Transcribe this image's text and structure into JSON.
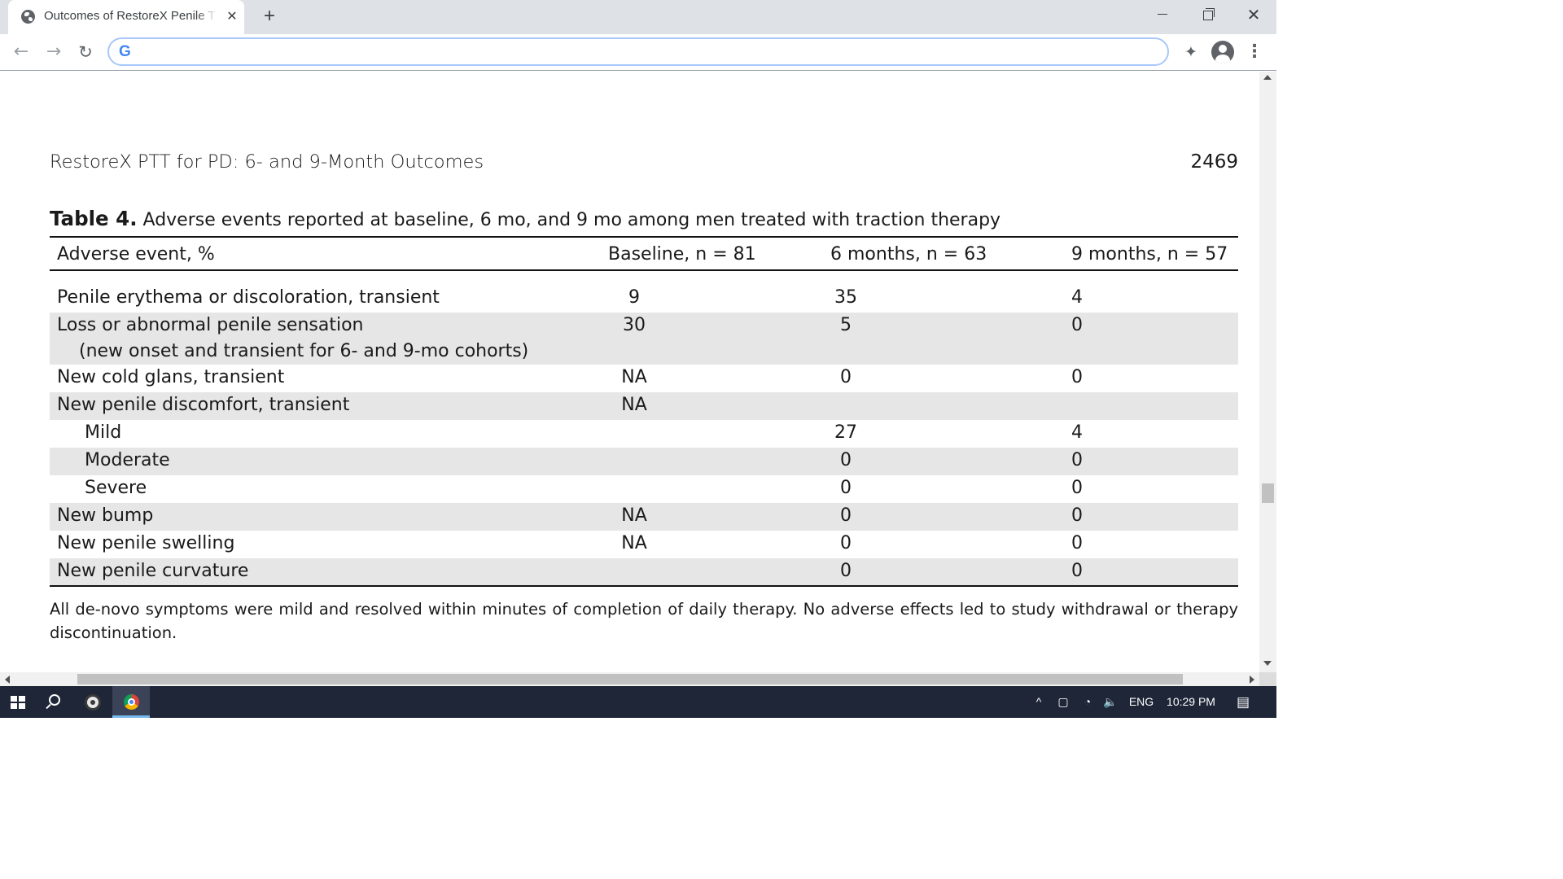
{
  "browser": {
    "tab_title": "Outcomes of RestoreX Penile Traction Therapy",
    "tab_close": "✕",
    "new_tab": "+",
    "window_close": "✕",
    "address_value": "",
    "search_engine_glyph": "G",
    "back_icon": "←",
    "forward_icon": "→",
    "reload_icon": "↻",
    "extensions_icon": "✦",
    "menu_icon": "⋮"
  },
  "document": {
    "running_head": "RestoreX PTT for PD: 6- and 9-Month Outcomes",
    "page_number": "2469",
    "caption_label": "Table 4.",
    "caption_text": "Adverse events reported at baseline, 6 mo, and 9 mo among men treated with traction therapy",
    "headers": [
      "Adverse event, %",
      "Baseline, n = 81",
      "6 months, n = 63",
      "9 months, n = 57"
    ],
    "rows": [
      {
        "label": "Penile erythema or discoloration, transient",
        "sublabel": "",
        "baseline": "9",
        "six": "35",
        "nine": "4"
      },
      {
        "label": "Loss or abnormal penile sensation",
        "sublabel": "(new onset and transient for 6- and 9-mo cohorts)",
        "baseline": "30",
        "six": "5",
        "nine": "0"
      },
      {
        "label": "New cold glans, transient",
        "sublabel": "",
        "baseline": "NA",
        "six": "0",
        "nine": "0"
      },
      {
        "label": "New penile discomfort, transient",
        "sublabel": "",
        "baseline": "NA",
        "six": "",
        "nine": ""
      },
      {
        "label": "Mild",
        "sublabel": "",
        "baseline": "",
        "six": "27",
        "nine": "4"
      },
      {
        "label": "Moderate",
        "sublabel": "",
        "baseline": "",
        "six": "0",
        "nine": "0"
      },
      {
        "label": "Severe",
        "sublabel": "",
        "baseline": "",
        "six": "0",
        "nine": "0"
      },
      {
        "label": "New bump",
        "sublabel": "",
        "baseline": "NA",
        "six": "0",
        "nine": "0"
      },
      {
        "label": "New penile swelling",
        "sublabel": "",
        "baseline": "NA",
        "six": "0",
        "nine": "0"
      },
      {
        "label": "New penile curvature",
        "sublabel": "",
        "baseline": "",
        "six": "0",
        "nine": "0"
      }
    ],
    "footnote": "All de-novo symptoms were mild and resolved within minutes of completion of daily therapy. No adverse effects led to study withdrawal or therapy discontinuation."
  },
  "taskbar": {
    "tray_chevron": "^",
    "tray_meet": "▢",
    "tray_network": "◔",
    "tray_volume": "🔈",
    "language": "ENG",
    "clock": "10:29 PM",
    "notifications_icon": "▤"
  },
  "colors": {
    "row_shade": "#e6e6e6",
    "taskbar": "#1f2638",
    "omnibox_border": "#a8c7fa",
    "tabstrip": "#dee1e6"
  }
}
